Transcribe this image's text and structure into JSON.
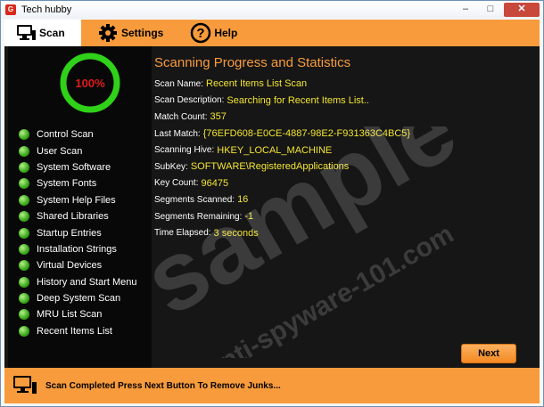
{
  "window": {
    "title": "Tech hubby",
    "minimize": "–",
    "maximize": "□",
    "close": "✕"
  },
  "tabs": [
    {
      "label": "Scan",
      "icon": "computer-icon"
    },
    {
      "label": "Settings",
      "icon": "gear-icon"
    },
    {
      "label": "Help",
      "icon": "help-icon"
    }
  ],
  "gauge": {
    "label": "100%",
    "value": 1.0
  },
  "nav": [
    "Control Scan",
    "User Scan",
    "System Software",
    "System Fonts",
    "System Help Files",
    "Shared Libraries",
    "Startup Entries",
    "Installation Strings",
    "Virtual Devices",
    "History and Start Menu",
    "Deep System Scan",
    "MRU List Scan",
    "Recent Items List"
  ],
  "content": {
    "heading": "Scanning Progress and Statistics",
    "rows": [
      {
        "key": "Scan Name:",
        "value": "Recent Items List Scan"
      },
      {
        "key": "Scan Description:",
        "value": "Searching for Recent Items List.."
      },
      {
        "key": "Match Count:",
        "value": "357"
      },
      {
        "key": "Last Match:",
        "value": "{76EFD608-E0CE-4887-98E2-F931363C4BC5}"
      },
      {
        "key": "Scanning Hive:",
        "value": "HKEY_LOCAL_MACHINE"
      },
      {
        "key": "SubKey:",
        "value": "SOFTWARE\\RegisteredApplications"
      },
      {
        "key": "Key Count:",
        "value": "96475"
      },
      {
        "key": "Segments Scanned:",
        "value": "16"
      },
      {
        "key": "Segments Remaining:",
        "value": "-1"
      },
      {
        "key": "Time Elapsed:",
        "value": "3 seconds"
      }
    ],
    "next_label": "Next"
  },
  "watermark": {
    "big": "sample",
    "small": "anti-spyware-101.com"
  },
  "status": {
    "text": "Scan Completed Press Next Button To Remove Junks..."
  },
  "colors": {
    "accent": "#f89b3c",
    "value_text": "#f3e531",
    "gauge": "#2fd119",
    "gauge_label": "#e01b1b"
  }
}
